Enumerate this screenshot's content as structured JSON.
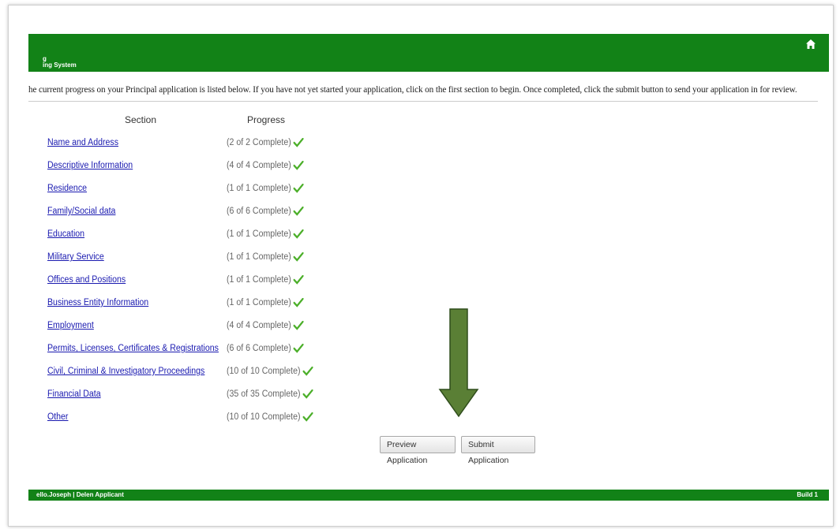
{
  "header": {
    "line1": "g",
    "line2": "ing System"
  },
  "intro_text": "he current progress on your Principal application is listed below. If you have not yet started your application, click on the first section to begin. Once completed, click the submit button to send your application in for review.",
  "table": {
    "col_section": "Section",
    "col_progress": "Progress",
    "rows": [
      {
        "section": "Name and Address",
        "progress": "(2 of 2 Complete)"
      },
      {
        "section": "Descriptive Information",
        "progress": "(4 of 4 Complete)"
      },
      {
        "section": "Residence",
        "progress": "(1 of 1 Complete)"
      },
      {
        "section": "Family/Social data",
        "progress": "(6 of 6 Complete)"
      },
      {
        "section": "Education",
        "progress": "(1 of 1 Complete)"
      },
      {
        "section": "Military Service",
        "progress": "(1 of 1 Complete)"
      },
      {
        "section": "Offices and Positions",
        "progress": "(1 of 1 Complete)"
      },
      {
        "section": "Business Entity Information",
        "progress": "(1 of 1 Complete)"
      },
      {
        "section": "Employment",
        "progress": "(4 of 4 Complete)"
      },
      {
        "section": "Permits, Licenses, Certificates & Registrations",
        "progress": "(6 of 6 Complete)"
      },
      {
        "section": "Civil, Criminal & Investigatory Proceedings",
        "progress": "(10 of 10 Complete)"
      },
      {
        "section": "Financial Data",
        "progress": "(35 of 35 Complete)"
      },
      {
        "section": "Other",
        "progress": "(10 of 10 Complete)"
      }
    ]
  },
  "buttons": {
    "preview": "Preview Application",
    "submit": "Submit Application"
  },
  "footer": {
    "left": "ello.Joseph | Delen Applicant",
    "right": "Build 1"
  },
  "colors": {
    "header_green": "#128217",
    "check_green": "#4caf2a",
    "arrow_green": "#5a7f35",
    "link_blue": "#1a1ab0"
  },
  "icons": {
    "home": "home-icon",
    "check": "check-icon",
    "arrow": "down-arrow-icon"
  }
}
